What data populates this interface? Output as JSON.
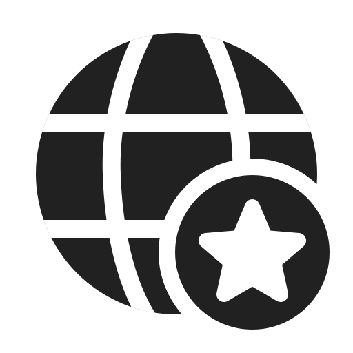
{
  "icon": {
    "name": "globe-star-icon",
    "parts": [
      "globe-icon",
      "star-badge-icon"
    ],
    "colors": {
      "foreground": "#212121",
      "background": "#ffffff"
    }
  }
}
